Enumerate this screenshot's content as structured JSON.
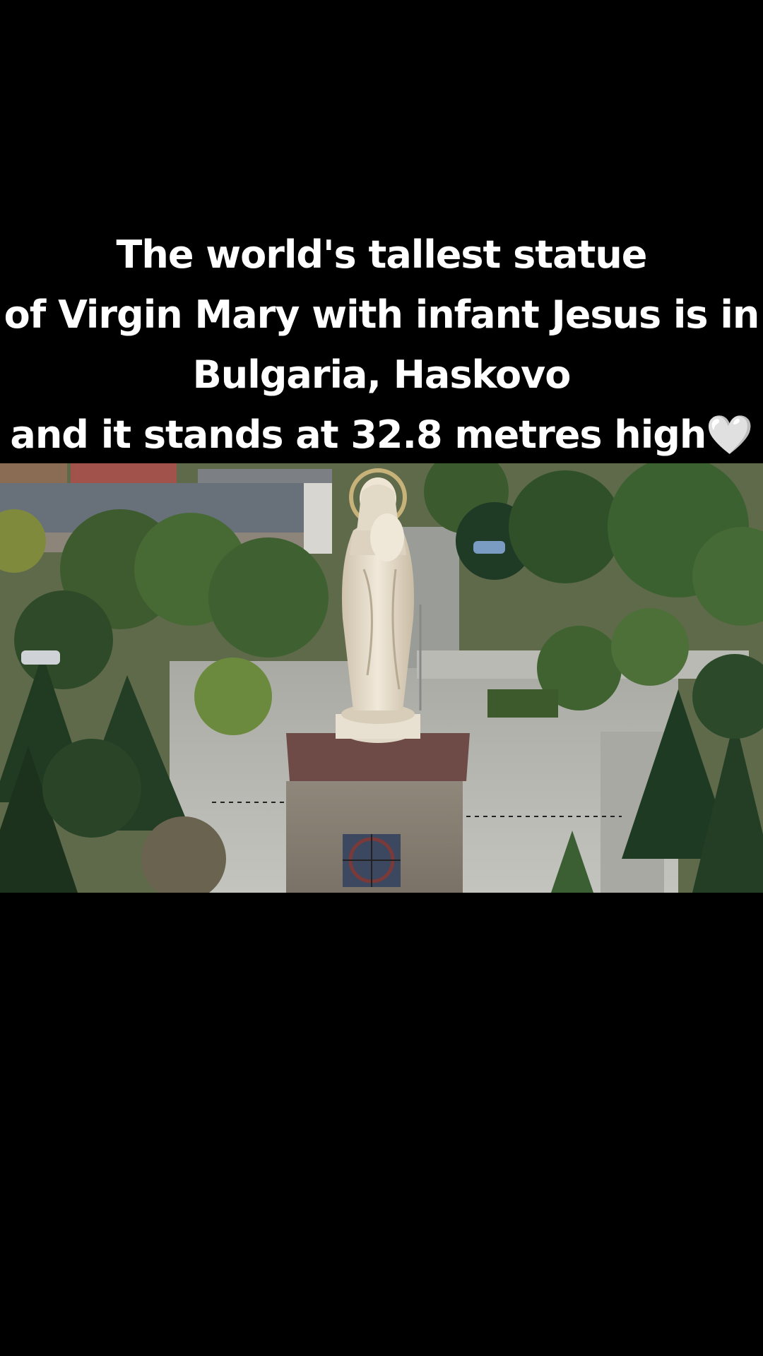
{
  "caption": {
    "line1": "The world's tallest statue",
    "line2": "of Virgin Mary with infant Jesus is in",
    "line3": "Bulgaria, Haskovo",
    "line4": "and it stands at 32.8 metres high🤍"
  },
  "video": {
    "subject": "aerial-view-statue-virgin-mary-haskovo",
    "colors": {
      "background": "#000000",
      "caption_text": "#ffffff",
      "foliage": "#3f5e34",
      "pavement": "#b7b7b1",
      "statue": "#e6dccb",
      "roof": "#6b7178"
    }
  }
}
